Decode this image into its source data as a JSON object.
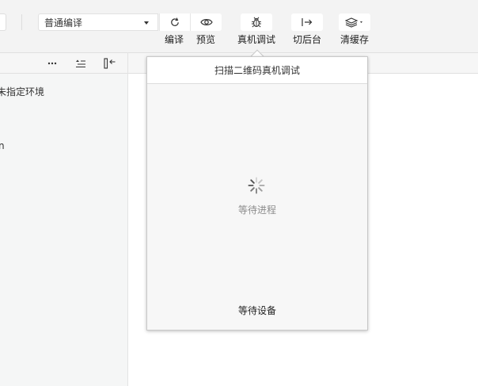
{
  "toolbar": {
    "mode_select": {
      "value": "普通编译"
    },
    "tools": {
      "compile": {
        "label": "编译",
        "icon": "refresh-icon"
      },
      "preview": {
        "label": "预览",
        "icon": "eye-icon"
      },
      "remote_debug": {
        "label": "真机调试",
        "icon": "bug-icon"
      },
      "backend": {
        "label": "切后台",
        "icon": "switch-background-icon"
      },
      "clear_cache": {
        "label": "清缓存",
        "icon": "layers-icon"
      }
    }
  },
  "left_panel": {
    "header_icons": [
      "more-icon",
      "sort-icon",
      "collapse-panel-icon"
    ],
    "lines": [
      "未指定环境",
      "n"
    ]
  },
  "popup": {
    "title": "扫描二维码真机调试",
    "status": "等待进程",
    "footer": "等待设备"
  }
}
